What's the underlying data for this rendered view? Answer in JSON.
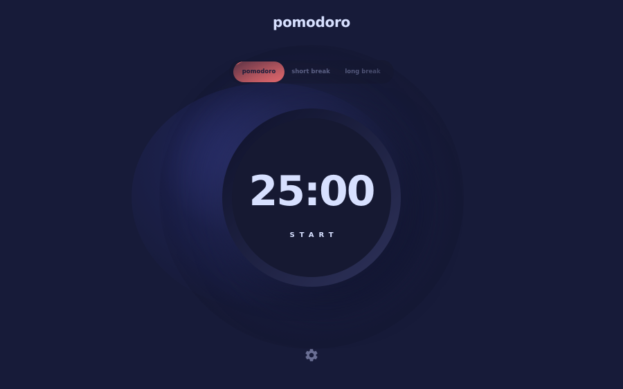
{
  "app": {
    "title": "pomodoro"
  },
  "modes": {
    "items": [
      {
        "label": "pomodoro",
        "active": true
      },
      {
        "label": "short break",
        "active": false
      },
      {
        "label": "long break",
        "active": false
      }
    ]
  },
  "timer": {
    "time": "25:00",
    "action_label": "START"
  },
  "settings": {
    "icon": "gear-icon"
  },
  "colors": {
    "background": "#171b39",
    "accent": "#f87070",
    "text": "#d7e0ff",
    "muted_text": "#6a6f94",
    "panel": "#161932"
  }
}
